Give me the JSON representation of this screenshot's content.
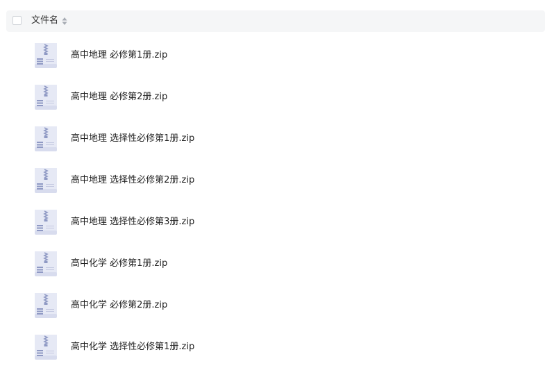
{
  "header": {
    "column_title": "文件名"
  },
  "files": [
    {
      "name": "高中地理 必修第1册.zip",
      "icon": "zip-file-icon"
    },
    {
      "name": "高中地理 必修第2册.zip",
      "icon": "zip-file-icon"
    },
    {
      "name": "高中地理 选择性必修第1册.zip",
      "icon": "zip-file-icon"
    },
    {
      "name": "高中地理 选择性必修第2册.zip",
      "icon": "zip-file-icon"
    },
    {
      "name": "高中地理 选择性必修第3册.zip",
      "icon": "zip-file-icon"
    },
    {
      "name": "高中化学 必修第1册.zip",
      "icon": "zip-file-icon"
    },
    {
      "name": "高中化学 必修第2册.zip",
      "icon": "zip-file-icon"
    },
    {
      "name": "高中化学 选择性必修第1册.zip",
      "icon": "zip-file-icon"
    }
  ],
  "colors": {
    "header_bg": "#f5f6f7",
    "icon_body": "#e6e9f5",
    "icon_accent": "#8f99c4"
  }
}
